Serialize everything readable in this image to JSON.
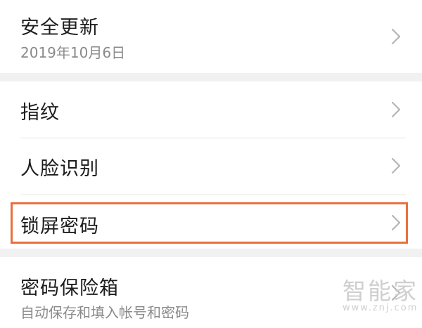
{
  "rows": [
    {
      "title": "安全更新",
      "subtitle": "2019年10月6日"
    },
    {
      "title": "指纹"
    },
    {
      "title": "人脸识别"
    },
    {
      "title": "锁屏密码"
    },
    {
      "title": "密码保险箱",
      "subtitle": "自动保存和填入帐号和密码"
    }
  ],
  "watermark": {
    "name": "智能家",
    "url": "www.znj.com"
  },
  "colors": {
    "highlight": "#e8703d",
    "section_gap": "#f1f1f1"
  },
  "icons": {
    "row_arrow": "chevron-right-icon"
  }
}
